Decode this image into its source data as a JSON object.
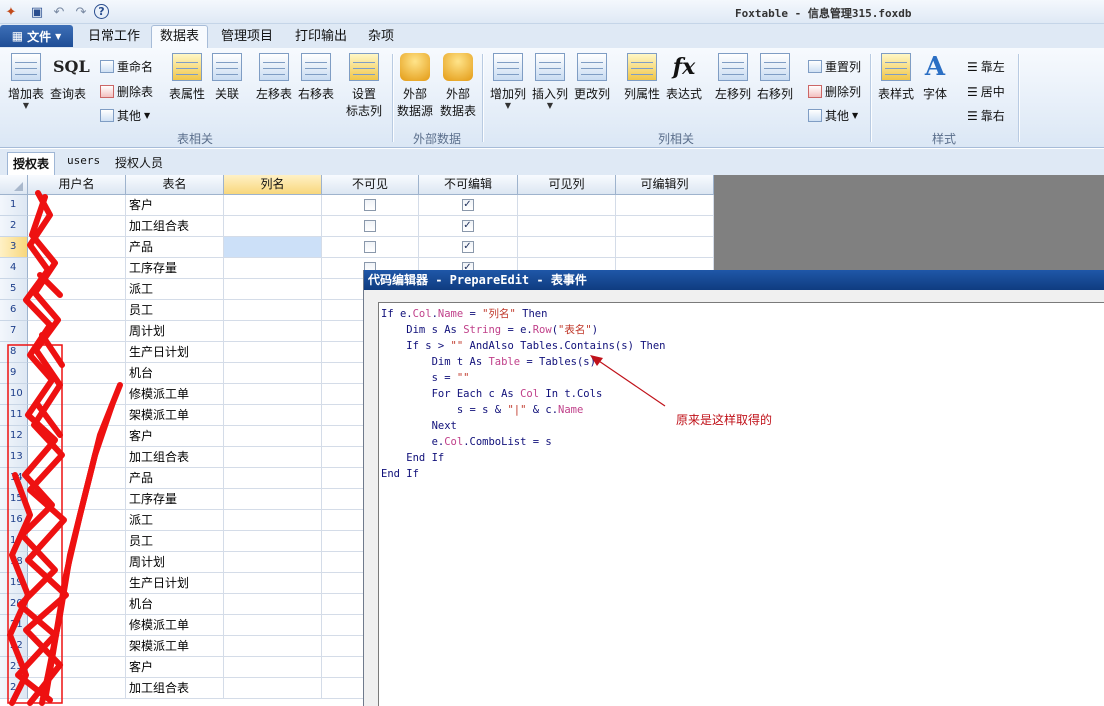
{
  "titlebar": {
    "title": "Foxtable - 信息管理315.foxdb",
    "quick_access": [
      "app-icon",
      "save-icon",
      "undo-icon",
      "redo-icon",
      "help-icon"
    ]
  },
  "menu": {
    "file_label": "文件",
    "tabs": [
      "日常工作",
      "数据表",
      "管理项目",
      "打印输出",
      "杂项"
    ],
    "active_tab": "数据表"
  },
  "ribbon": {
    "groups": {
      "table": "表相关",
      "external": "外部数据",
      "column": "列相关",
      "style": "样式"
    },
    "buttons": {
      "add_table": "增加表",
      "query_table": "查询表",
      "rename": "重命名",
      "delete_table": "删除表",
      "other1": "其他",
      "table_props": "表属性",
      "relation": "关联",
      "move_left_table": "左移表",
      "move_right_table": "右移表",
      "set_flag_col_1": "设置",
      "set_flag_col_2": "标志列",
      "ext_source_1": "外部",
      "ext_source_2": "数据源",
      "ext_table_1": "外部",
      "ext_table_2": "数据表",
      "add_col": "增加列",
      "insert_col": "插入列",
      "change_col": "更改列",
      "col_props": "列属性",
      "expression": "表达式",
      "move_left_col": "左移列",
      "move_right_col": "右移列",
      "reset_col": "重置列",
      "delete_col": "删除列",
      "other2": "其他",
      "table_style": "表样式",
      "font": "字体",
      "align_left": "靠左",
      "align_center": "居中",
      "align_right": "靠右"
    }
  },
  "sheet_tabs": [
    "授权表",
    "users",
    "授权人员"
  ],
  "active_sheet": "授权表",
  "grid": {
    "columns": [
      "用户名",
      "表名",
      "列名",
      "不可见",
      "不可编辑",
      "可见列",
      "可编辑列"
    ],
    "current_row": 3,
    "rows": [
      {
        "n": "1",
        "table": "客户",
        "invisible": false,
        "noedit": true
      },
      {
        "n": "2",
        "table": "加工组合表",
        "invisible": false,
        "noedit": true
      },
      {
        "n": "3",
        "table": "产品",
        "invisible": false,
        "noedit": true
      },
      {
        "n": "4",
        "table": "工序存量",
        "invisible": false,
        "noedit": true
      },
      {
        "n": "5",
        "table": "派工",
        "invisible": null,
        "noedit": null
      },
      {
        "n": "6",
        "table": "员工",
        "invisible": null,
        "noedit": null
      },
      {
        "n": "7",
        "table": "周计划",
        "invisible": null,
        "noedit": null
      },
      {
        "n": "8",
        "table": "生产日计划",
        "invisible": null,
        "noedit": null
      },
      {
        "n": "9",
        "table": "机台",
        "invisible": null,
        "noedit": null
      },
      {
        "n": "10",
        "table": "修模派工单",
        "invisible": null,
        "noedit": null
      },
      {
        "n": "11",
        "table": "架模派工单",
        "invisible": null,
        "noedit": null
      },
      {
        "n": "12",
        "table": "客户",
        "invisible": null,
        "noedit": null
      },
      {
        "n": "13",
        "table": "加工组合表",
        "invisible": null,
        "noedit": null
      },
      {
        "n": "14",
        "table": "产品",
        "invisible": null,
        "noedit": null
      },
      {
        "n": "15",
        "table": "工序存量",
        "invisible": null,
        "noedit": null
      },
      {
        "n": "16",
        "table": "派工",
        "invisible": null,
        "noedit": null
      },
      {
        "n": "17",
        "table": "员工",
        "invisible": null,
        "noedit": null
      },
      {
        "n": "18",
        "table": "周计划",
        "invisible": null,
        "noedit": null
      },
      {
        "n": "19",
        "table": "生产日计划",
        "invisible": null,
        "noedit": null
      },
      {
        "n": "20",
        "table": "机台",
        "invisible": null,
        "noedit": null
      },
      {
        "n": "21",
        "table": "修模派工单",
        "invisible": null,
        "noedit": null
      },
      {
        "n": "22",
        "table": "架模派工单",
        "invisible": null,
        "noedit": null
      },
      {
        "n": "23",
        "table": "客户",
        "invisible": null,
        "noedit": null
      },
      {
        "n": "24",
        "table": "加工组合表",
        "invisible": null,
        "noedit": null
      }
    ]
  },
  "editor": {
    "title": "代码编辑器 - PrepareEdit - 表事件",
    "code_lines": [
      "If e.Col.Name = \"列名\" Then",
      "    Dim s As String = e.Row(\"表名\")",
      "    If s > \"\" AndAlso Tables.Contains(s) Then",
      "        Dim t As Table = Tables(s)",
      "        s = \"\"",
      "        For Each c As Col In t.Cols",
      "            s = s & \"|\" & c.Name",
      "        Next",
      "        e.Col.ComboList = s",
      "    End If",
      "End If"
    ]
  },
  "annotation": {
    "note": "原来是这样取得的",
    "color": "#c0121a"
  }
}
